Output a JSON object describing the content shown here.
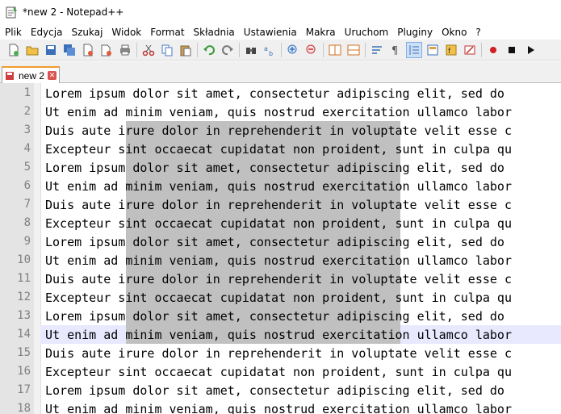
{
  "window": {
    "title": "*new 2 - Notepad++"
  },
  "menu": [
    "Plik",
    "Edycja",
    "Szukaj",
    "Widok",
    "Format",
    "Składnia",
    "Ustawienia",
    "Makra",
    "Uruchom",
    "Pluginy",
    "Okno",
    "?"
  ],
  "tab": {
    "label": "new 2",
    "close": "✕"
  },
  "lines": [
    {
      "n": "1",
      "text": "Lorem ipsum dolor sit amet, consectetur adipiscing elit, sed do"
    },
    {
      "n": "2",
      "text": "Ut enim ad minim veniam, quis nostrud exercitation ullamco labor"
    },
    {
      "n": "3",
      "text": "Duis aute irure dolor in reprehenderit in voluptate velit esse c"
    },
    {
      "n": "4",
      "text": "Excepteur sint occaecat cupidatat non proident, sunt in culpa qu"
    },
    {
      "n": "5",
      "text": "Lorem ipsum dolor sit amet, consectetur adipiscing elit, sed do"
    },
    {
      "n": "6",
      "text": "Ut enim ad minim veniam, quis nostrud exercitation ullamco labor"
    },
    {
      "n": "7",
      "text": "Duis aute irure dolor in reprehenderit in voluptate velit esse c"
    },
    {
      "n": "8",
      "text": "Excepteur sint occaecat cupidatat non proident, sunt in culpa qu"
    },
    {
      "n": "9",
      "text": "Lorem ipsum dolor sit amet, consectetur adipiscing elit, sed do"
    },
    {
      "n": "10",
      "text": "Ut enim ad minim veniam, quis nostrud exercitation ullamco labor"
    },
    {
      "n": "11",
      "text": "Duis aute irure dolor in reprehenderit in voluptate velit esse c"
    },
    {
      "n": "12",
      "text": "Excepteur sint occaecat cupidatat non proident, sunt in culpa qu"
    },
    {
      "n": "13",
      "text": "Lorem ipsum dolor sit amet, consectetur adipiscing elit, sed do"
    },
    {
      "n": "14",
      "text": "Ut enim ad minim veniam, quis nostrud exercitation ullamco labor"
    },
    {
      "n": "15",
      "text": "Duis aute irure dolor in reprehenderit in voluptate velit esse c"
    },
    {
      "n": "16",
      "text": "Excepteur sint occaecat cupidatat non proident, sunt in culpa qu"
    },
    {
      "n": "17",
      "text": "Lorem ipsum dolor sit amet, consectetur adipiscing elit, sed do"
    },
    {
      "n": "18",
      "text": "Ut enim ad minim veniam, quis nostrud exercitation ullamco labor"
    }
  ],
  "colors": {
    "selection": "#c0c0c0",
    "gutter": "#e4e4e4",
    "tab_accent": "#f29b2d",
    "current_line": "#e8e8ff"
  }
}
